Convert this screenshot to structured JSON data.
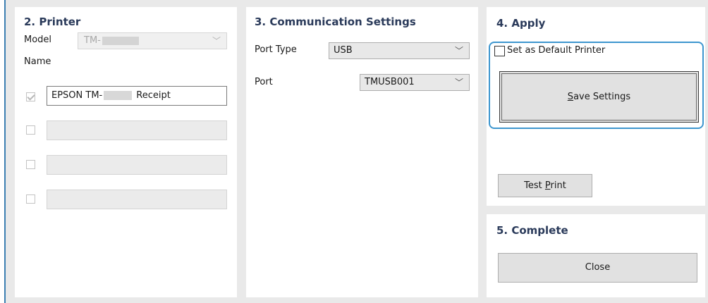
{
  "printer": {
    "title": "2. Printer",
    "model_label": "Model",
    "model_value": "TM-",
    "name_label": "Name",
    "names": [
      {
        "prefix": "EPSON TM-",
        "suffix": "Receipt",
        "checked": true
      },
      {
        "prefix": "",
        "suffix": "",
        "checked": false
      },
      {
        "prefix": "",
        "suffix": "",
        "checked": false
      },
      {
        "prefix": "",
        "suffix": "",
        "checked": false
      }
    ]
  },
  "communication": {
    "title": "3. Communication Settings",
    "port_type_label": "Port Type",
    "port_type_value": "USB",
    "port_label": "Port",
    "port_value": "TMUSB001"
  },
  "apply": {
    "title": "4. Apply",
    "default_label": "Set as Default Printer",
    "save_first": "S",
    "save_rest": "ave Settings",
    "test_prefix": "Test ",
    "test_underline": "P",
    "test_rest": "rint"
  },
  "complete": {
    "title": "5. Complete",
    "close_label": "Close"
  },
  "icons": {
    "chevron": "chevron-down-icon",
    "check": "check-icon"
  },
  "colors": {
    "highlight": "#3d96cf",
    "title": "#2a3a5a"
  }
}
